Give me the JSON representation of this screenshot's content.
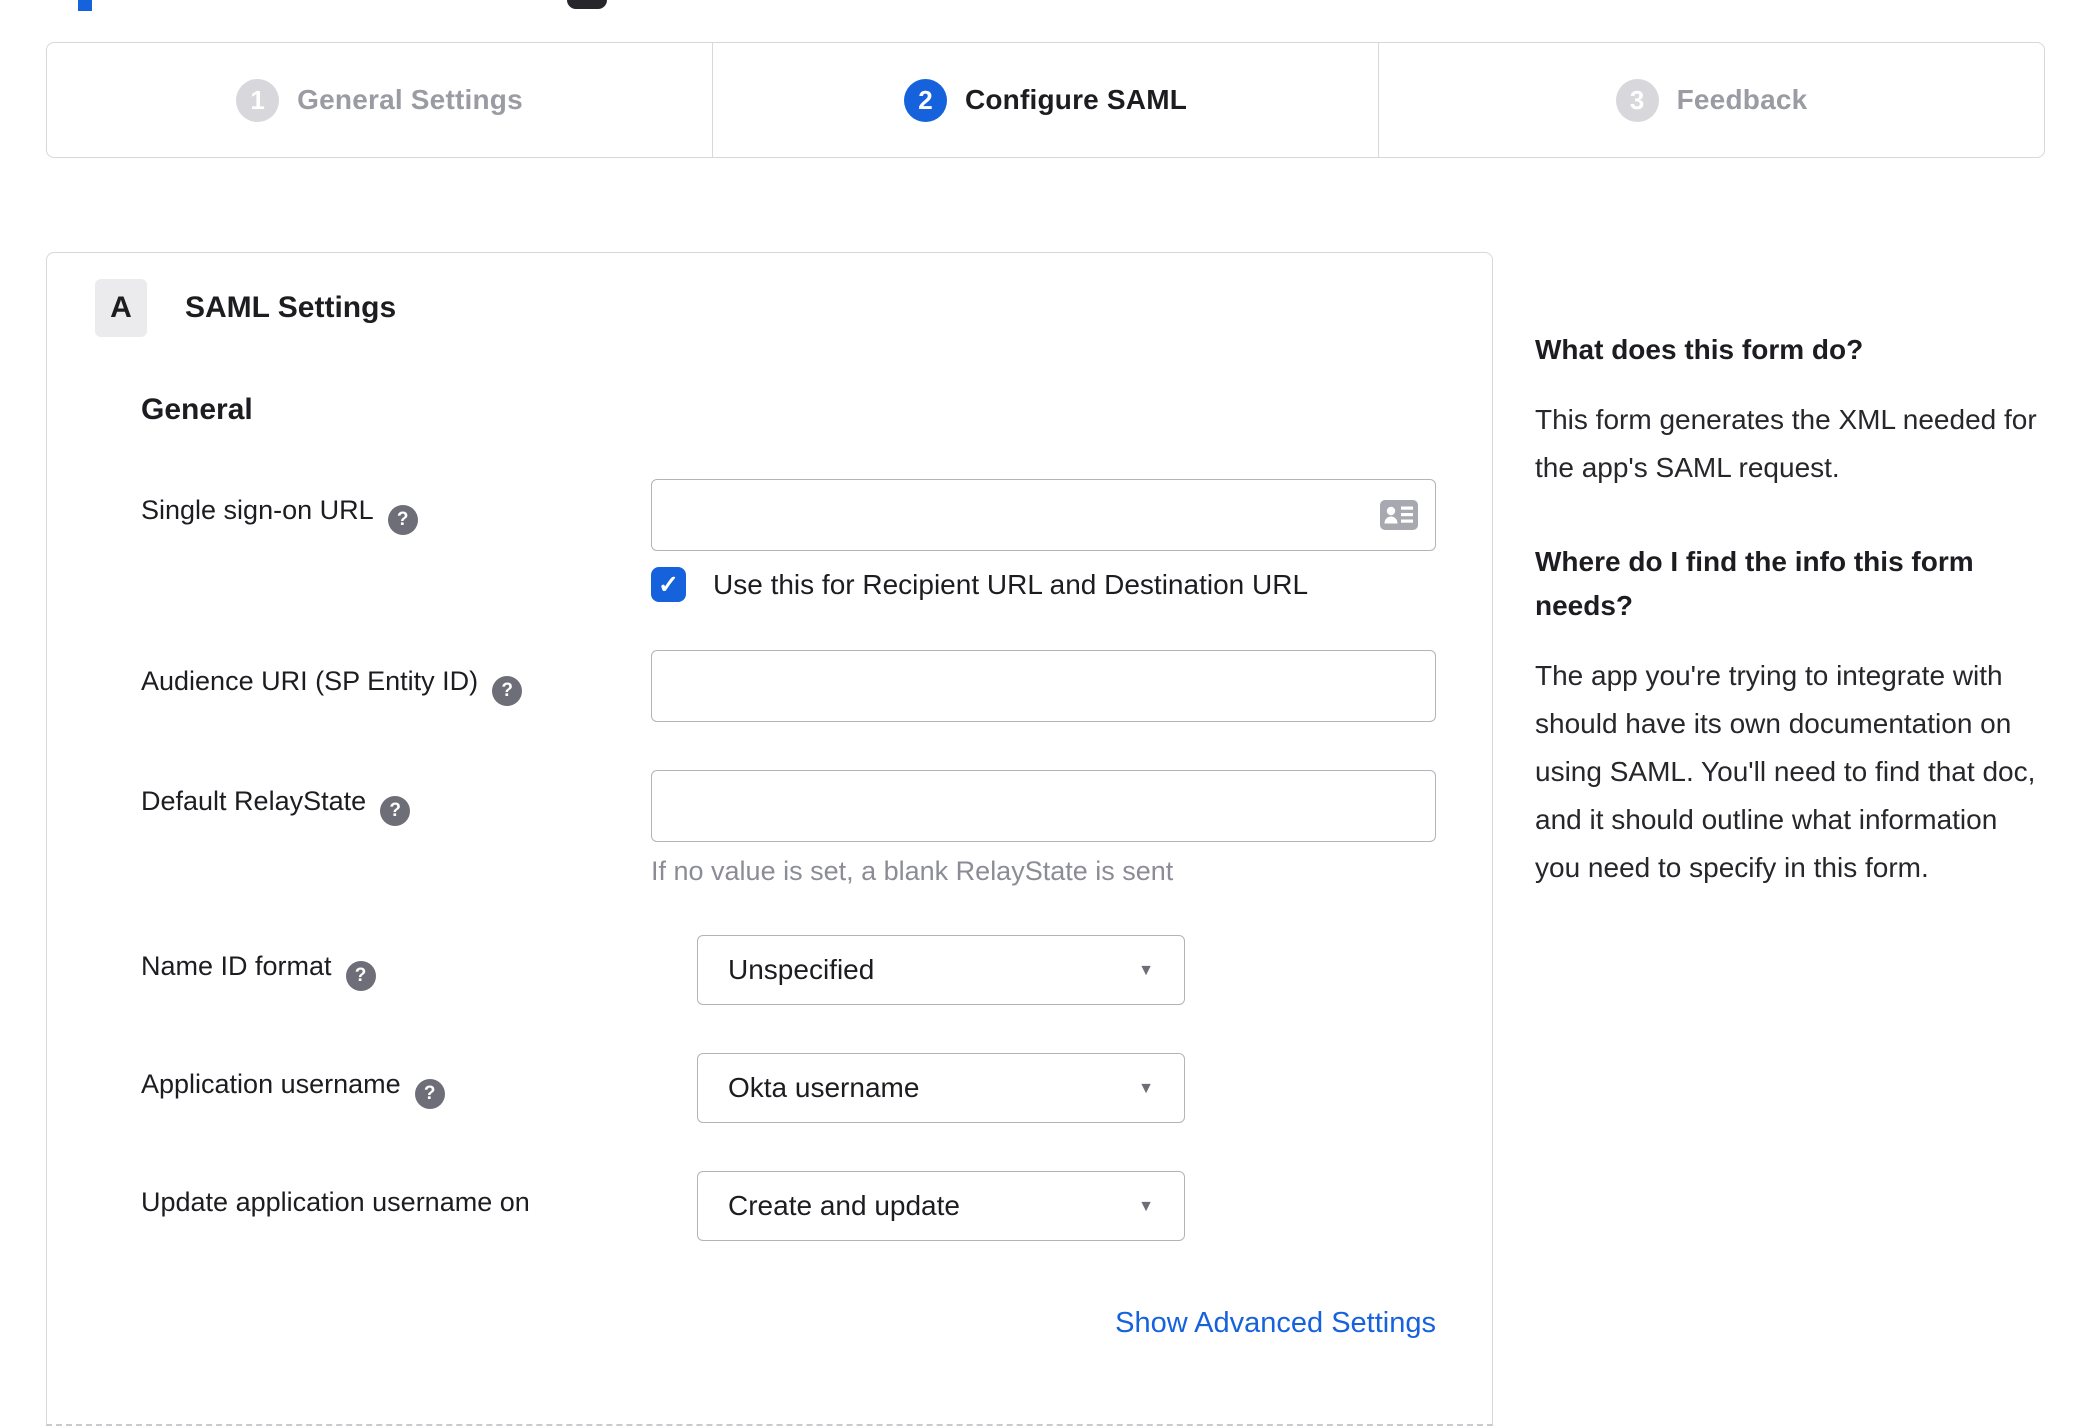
{
  "icons": {
    "check": "✓",
    "caret": "▼",
    "help": "?"
  },
  "colors": {
    "accent": "#1662dd"
  },
  "stepper": {
    "steps": [
      {
        "number": "1",
        "label": "General Settings"
      },
      {
        "number": "2",
        "label": "Configure SAML"
      },
      {
        "number": "3",
        "label": "Feedback"
      }
    ]
  },
  "panel": {
    "badge": "A",
    "title": "SAML Settings",
    "section": "General",
    "fields": {
      "sso": {
        "label": "Single sign-on URL",
        "value": "",
        "checkbox_label": "Use this for Recipient URL and Destination URL"
      },
      "audience": {
        "label": "Audience URI (SP Entity ID)",
        "value": ""
      },
      "relay": {
        "label": "Default RelayState",
        "value": "",
        "helper": "If no value is set, a blank RelayState is sent"
      },
      "nameid": {
        "label": "Name ID format",
        "value": "Unspecified"
      },
      "appuser": {
        "label": "Application username",
        "value": "Okta username"
      },
      "updateuser": {
        "label": "Update application username on",
        "value": "Create and update"
      }
    },
    "advanced_link": "Show Advanced Settings"
  },
  "sidebar": {
    "q1": "What does this form do?",
    "a1": "This form generates the XML needed for the app's SAML request.",
    "q2": "Where do I find the info this form needs?",
    "a2": "The app you're trying to integrate with should have its own documentation on using SAML. You'll need to find that doc, and it should outline what information you need to specify in this form."
  }
}
